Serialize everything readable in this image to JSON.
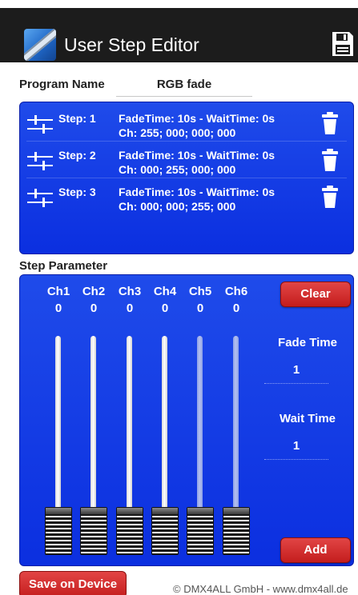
{
  "app": {
    "title": "User Step Editor",
    "logo_icon": "app-logo-icon",
    "save_icon": "save-icon"
  },
  "program": {
    "label": "Program Name",
    "value": "RGB fade"
  },
  "steps": [
    {
      "name": "Step: 1",
      "timing": "FadeTime: 10s - WaitTime: 0s",
      "channels": "Ch: 255; 000; 000; 000"
    },
    {
      "name": "Step: 2",
      "timing": "FadeTime: 10s - WaitTime: 0s",
      "channels": "Ch: 000; 255; 000; 000"
    },
    {
      "name": "Step: 3",
      "timing": "FadeTime: 10s - WaitTime: 0s",
      "channels": "Ch: 000; 000; 255; 000"
    }
  ],
  "parameter": {
    "label": "Step Parameter",
    "channels": [
      {
        "name": "Ch1",
        "value": "0",
        "level": 0
      },
      {
        "name": "Ch2",
        "value": "0",
        "level": 0
      },
      {
        "name": "Ch3",
        "value": "0",
        "level": 0
      },
      {
        "name": "Ch4",
        "value": "0",
        "level": 0
      },
      {
        "name": "Ch5",
        "value": "0",
        "level": 0
      },
      {
        "name": "Ch6",
        "value": "0",
        "level": 0
      }
    ],
    "clear_label": "Clear",
    "add_label": "Add",
    "fade_time_label": "Fade Time",
    "fade_time_value": "1",
    "wait_time_label": "Wait Time",
    "wait_time_value": "1"
  },
  "footer": {
    "save_button": "Save on Device",
    "copyright": "© DMX4ALL GmbH - www.dmx4all.de"
  },
  "colors": {
    "panel_blue": "#0b2fe0",
    "button_red": "#c41d1d",
    "appbar": "#1c1c1c"
  }
}
